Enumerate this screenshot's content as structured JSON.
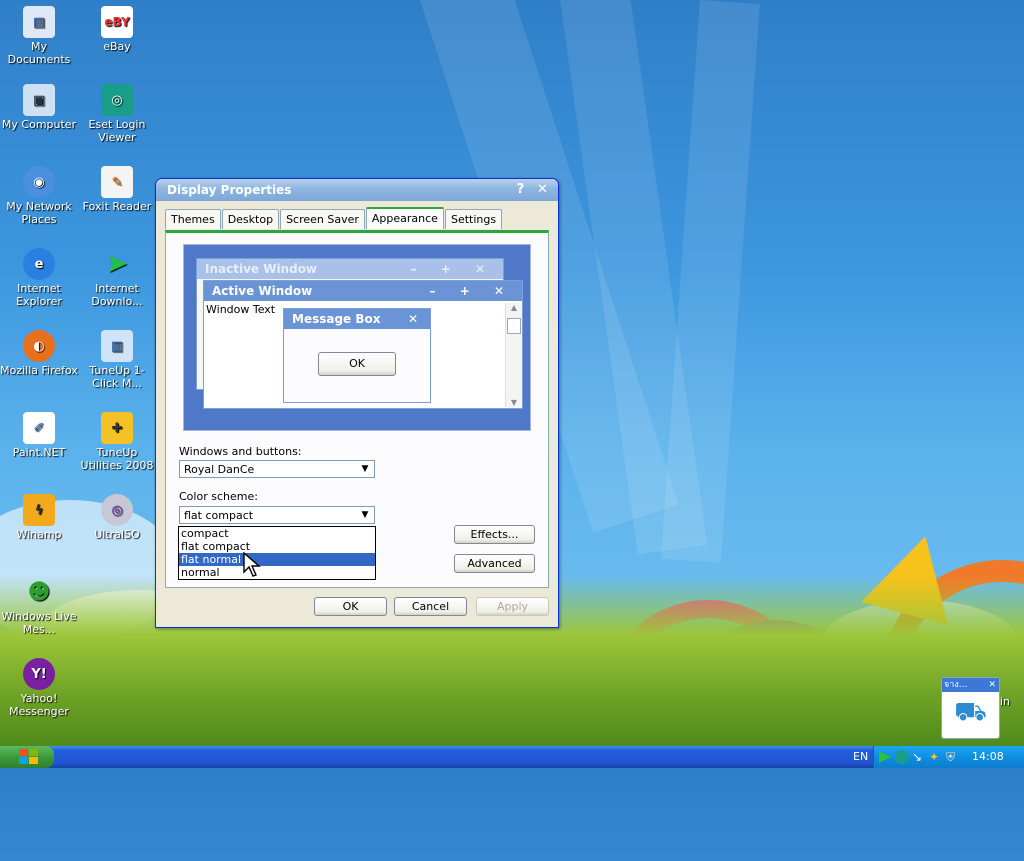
{
  "desktop_icons": [
    {
      "label": "My Documents",
      "icon": "my-documents-icon"
    },
    {
      "label": "eBay",
      "icon": "ebay-icon"
    },
    {
      "label": "My Computer",
      "icon": "my-computer-icon"
    },
    {
      "label": "Eset Login Viewer",
      "icon": "eset-icon"
    },
    {
      "label": "My Network Places",
      "icon": "network-places-icon"
    },
    {
      "label": "Foxit Reader",
      "icon": "foxit-icon"
    },
    {
      "label": "Internet Explorer",
      "icon": "internet-explorer-icon"
    },
    {
      "label": "Internet Downlo...",
      "icon": "idm-icon"
    },
    {
      "label": "Mozilla Firefox",
      "icon": "firefox-icon"
    },
    {
      "label": "TuneUp 1-Click M...",
      "icon": "tuneup-icon"
    },
    {
      "label": "Paint.NET",
      "icon": "paintnet-icon"
    },
    {
      "label": "TuneUp Utilities 2008",
      "icon": "tuneup-utilities-icon"
    },
    {
      "label": "Winamp",
      "icon": "winamp-icon"
    },
    {
      "label": "UltraISO",
      "icon": "ultraiso-icon"
    },
    {
      "label": "Windows Live Mes...",
      "icon": "messenger-icon"
    },
    {
      "label": "Yahoo! Messenger",
      "icon": "yahoo-icon"
    }
  ],
  "dialog": {
    "title": "Display Properties",
    "help_glyph": "?",
    "close_glyph": "✕",
    "tabs": [
      "Themes",
      "Desktop",
      "Screen Saver",
      "Appearance",
      "Settings"
    ],
    "active_tab": "Appearance",
    "preview": {
      "inactive_title": "Inactive Window",
      "active_title": "Active Window",
      "window_text": "Window Text",
      "message_box_title": "Message Box",
      "message_box_ok": "OK",
      "title_buttons": "– + ✕"
    },
    "windows_buttons_label": "Windows and buttons:",
    "windows_buttons_value": "Royal DanCe",
    "color_scheme_label": "Color scheme:",
    "color_scheme_value": "flat compact",
    "color_scheme_options": [
      "compact",
      "flat compact",
      "flat normal",
      "normal"
    ],
    "highlighted_option": "flat normal",
    "effects_button": "Effects...",
    "advanced_button": "Advanced",
    "ok_button": "OK",
    "cancel_button": "Cancel",
    "apply_button": "Apply"
  },
  "widget": {
    "title": "จาง...",
    "close_glyph": "✕",
    "caption": "in"
  },
  "taskbar": {
    "language": "EN",
    "clock": "14:08"
  }
}
